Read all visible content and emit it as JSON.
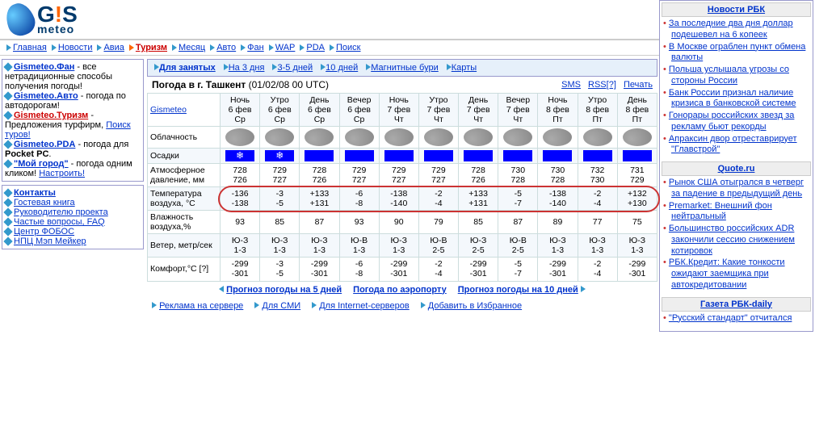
{
  "logo": {
    "main": "G!S",
    "sub": "meteo"
  },
  "main_nav": [
    "Главная",
    "Новости",
    "Авиа",
    "Туризм",
    "Месяц",
    "Авто",
    "Фан",
    "WAP",
    "PDA",
    "Поиск"
  ],
  "main_nav_highlight": 3,
  "sidebar1": [
    {
      "bold": "Gismeteo.Фан",
      "suffix": " - все нетрадиционные способы получения погоды!"
    },
    {
      "bold": "Gismeteo.Авто",
      "suffix": " - погода по автодорогам!"
    },
    {
      "bold": "Gismeteo.Туризм",
      "bold_class": "orange-link",
      "suffix": " - Предложения турфирм, ",
      "extra_link": "Поиск туров!"
    },
    {
      "bold": "Gismeteo.PDA",
      "suffix": " - погода для ",
      "bold2": "Pocket PC",
      "suffix2": "."
    },
    {
      "bold": "\"Мой город\"",
      "suffix": " - погода одним кликом! ",
      "extra_link": "Настроить!"
    }
  ],
  "sidebar2": {
    "title": "Контакты",
    "items": [
      "Гостевая книга",
      "Руководителю проекта",
      "Частые вопросы, FAQ",
      "Центр ФОБОС",
      "НПЦ Мэп Мейкер"
    ]
  },
  "sub_nav": [
    "Для занятых",
    "На 3 дня",
    "3-5 дней",
    "10 дней",
    "Магнитные бури",
    "Карты"
  ],
  "title": {
    "label": "Погода в г. Ташкент",
    "date": "(01/02/08 00 UTC)"
  },
  "title_links": {
    "sms": "SMS",
    "rss": "RSS[?]",
    "print": "Печать"
  },
  "gismeteo_link": "Gismeteo",
  "columns": [
    {
      "part": "Ночь",
      "date": "6 фев",
      "day": "Ср"
    },
    {
      "part": "Утро",
      "date": "6 фев",
      "day": "Ср"
    },
    {
      "part": "День",
      "date": "6 фев",
      "day": "Ср"
    },
    {
      "part": "Вечер",
      "date": "6 фев",
      "day": "Ср"
    },
    {
      "part": "Ночь",
      "date": "7 фев",
      "day": "Чт"
    },
    {
      "part": "Утро",
      "date": "7 фев",
      "day": "Чт"
    },
    {
      "part": "День",
      "date": "7 фев",
      "day": "Чт"
    },
    {
      "part": "Вечер",
      "date": "7 фев",
      "day": "Чт"
    },
    {
      "part": "Ночь",
      "date": "8 фев",
      "day": "Пт"
    },
    {
      "part": "Утро",
      "date": "8 фев",
      "day": "Пт"
    },
    {
      "part": "День",
      "date": "8 фев",
      "day": "Пт"
    }
  ],
  "rows": {
    "clouds": "Облачность",
    "precip": {
      "label": "Осадки",
      "types": [
        "snow",
        "snow",
        "blue",
        "blue",
        "blue",
        "blue",
        "blue",
        "blue",
        "blue",
        "blue",
        "blue"
      ]
    },
    "pressure": {
      "label": "Атмосферное давление, мм",
      "v1": [
        "728",
        "729",
        "728",
        "729",
        "729",
        "729",
        "728",
        "730",
        "730",
        "732",
        "731"
      ],
      "v2": [
        "726",
        "727",
        "726",
        "727",
        "727",
        "727",
        "726",
        "728",
        "728",
        "730",
        "729"
      ]
    },
    "temp": {
      "label": "Температура воздуха, °C",
      "v1": [
        "-136",
        "-3",
        "+133",
        "-6",
        "-138",
        "-2",
        "+133",
        "-5",
        "-138",
        "-2",
        "+132"
      ],
      "v2": [
        "-138",
        "-5",
        "+131",
        "-8",
        "-140",
        "-4",
        "+131",
        "-7",
        "-140",
        "-4",
        "+130"
      ]
    },
    "humidity": {
      "label": "Влажность воздуха,%",
      "v": [
        "93",
        "85",
        "87",
        "93",
        "90",
        "79",
        "85",
        "87",
        "89",
        "77",
        "75"
      ]
    },
    "wind": {
      "label": "Ветер, метр/сек",
      "dir": [
        "Ю-З",
        "Ю-З",
        "Ю-З",
        "Ю-В",
        "Ю-З",
        "Ю-В",
        "Ю-З",
        "Ю-В",
        "Ю-З",
        "Ю-З",
        "Ю-З"
      ],
      "sp": [
        "1-3",
        "1-3",
        "1-3",
        "1-3",
        "1-3",
        "2-5",
        "2-5",
        "2-5",
        "1-3",
        "1-3",
        "1-3"
      ]
    },
    "comfort": {
      "label": "Комфорт,°С [?]",
      "v1": [
        "-299",
        "-3",
        "-299",
        "-6",
        "-299",
        "-2",
        "-299",
        "-5",
        "-299",
        "-2",
        "-299"
      ],
      "v2": [
        "-301",
        "-5",
        "-301",
        "-8",
        "-301",
        "-4",
        "-301",
        "-7",
        "-301",
        "-4",
        "-301"
      ]
    }
  },
  "footer1": [
    "Прогноз погоды на 5 дней",
    "Погода по аэропорту",
    "Прогноз погоды на 10 дней"
  ],
  "footer2": [
    "Реклама на сервере",
    "Для СМИ",
    "Для Internet-серверов",
    "Добавить в Избранное"
  ],
  "news": [
    {
      "h": "Новости РБК",
      "items": [
        "За последние два дня доллар подешевел на 6 копеек",
        "В Москве ограблен пункт обмена валюты",
        "Польша услышала угрозы со стороны России",
        "Банк России признал наличие кризиса в банковской системе",
        "Гонорары российских звезд за рекламу бьют рекорды",
        "Апраксин двор отреставрирует \"Главстрой\""
      ]
    },
    {
      "h": "Quote.ru",
      "items": [
        "Рынок США отыгрался в четверг за падение в предыдущий день",
        "Premarket: Внешний фон нейтральный",
        "Большинство российских ADR закончили сессию снижением котировок",
        "РБК.Кредит: Какие тонкости ожидают заемщика при автокредитовании"
      ]
    },
    {
      "h": "Газета РБК-daily",
      "items": [
        "\"Русский стандарт\" отчитался"
      ]
    }
  ]
}
